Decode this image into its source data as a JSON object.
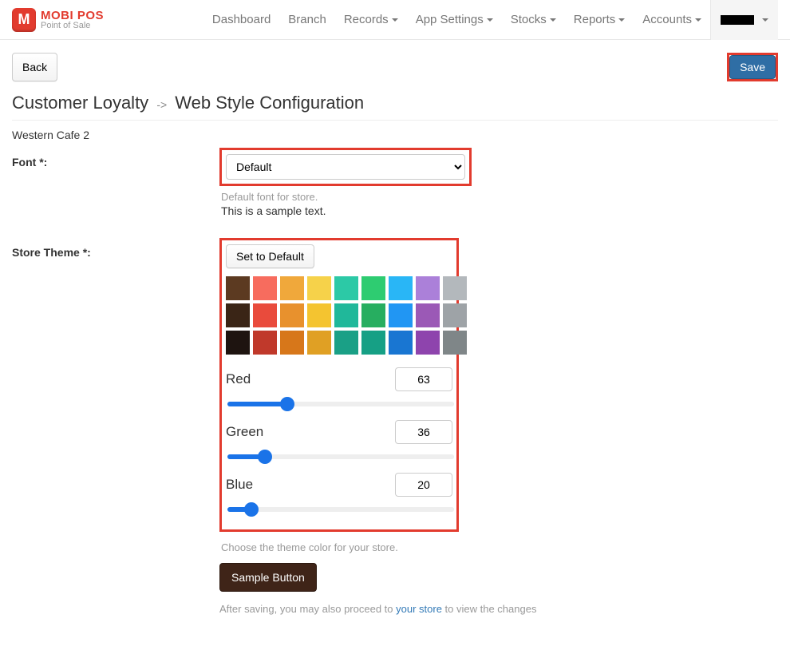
{
  "brand": {
    "title": "MOBI POS",
    "subtitle": "Point of Sale",
    "logo_letter": "M"
  },
  "nav": {
    "dashboard": "Dashboard",
    "branch": "Branch",
    "records": "Records",
    "app_settings": "App Settings",
    "stocks": "Stocks",
    "reports": "Reports",
    "accounts": "Accounts"
  },
  "toolbar": {
    "back": "Back",
    "save": "Save"
  },
  "title": {
    "section": "Customer Loyalty",
    "page": "Web Style Configuration"
  },
  "branch_name": "Western Cafe 2",
  "font": {
    "label": "Font *:",
    "selected": "Default",
    "helper": "Default font for store.",
    "sample": "This is a sample text."
  },
  "theme": {
    "label": "Store Theme *:",
    "reset": "Set to Default",
    "swatches": [
      [
        "#5c3a21",
        "#f76c5e",
        "#f0a83b",
        "#f6d24a",
        "#2cc9a6",
        "#2ecc71",
        "#29b6f6",
        "#ab80d9",
        "#b3b8bc"
      ],
      [
        "#3a2516",
        "#e94b3c",
        "#e8912d",
        "#f4c430",
        "#20b89a",
        "#27ae60",
        "#2196f3",
        "#9b59b6",
        "#9ea3a7"
      ],
      [
        "#1e1410",
        "#c0392b",
        "#d7771a",
        "#e0a024",
        "#1aa086",
        "#16a085",
        "#1976d2",
        "#8e44ad",
        "#7f8688"
      ]
    ],
    "red": {
      "label": "Red",
      "value": 63
    },
    "green": {
      "label": "Green",
      "value": 36
    },
    "blue": {
      "label": "Blue",
      "value": 20
    },
    "helper": "Choose the theme color for your store.",
    "sample_button": "Sample Button",
    "proceed_prefix": "After saving, you may also proceed to ",
    "proceed_link": "your store",
    "proceed_suffix": " to view the changes"
  }
}
